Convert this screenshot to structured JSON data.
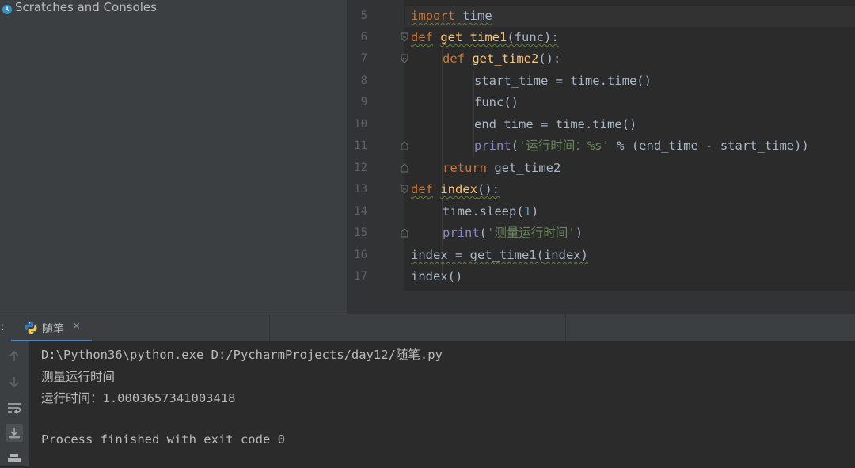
{
  "project_panel": {
    "item_label": "Scratches and Consoles"
  },
  "editor": {
    "lines": [
      {
        "num": "5"
      },
      {
        "num": "6"
      },
      {
        "num": "7"
      },
      {
        "num": "8"
      },
      {
        "num": "9"
      },
      {
        "num": "10"
      },
      {
        "num": "11"
      },
      {
        "num": "12"
      },
      {
        "num": "13"
      },
      {
        "num": "14"
      },
      {
        "num": "15"
      },
      {
        "num": "16"
      },
      {
        "num": "17"
      }
    ],
    "code": {
      "l5": {
        "kw": "import",
        "rest": " time"
      },
      "l6": {
        "kw": "def",
        "fn": "get_time1",
        "rest": "(func):"
      },
      "l7": {
        "kw": "def",
        "fn": "get_time2",
        "rest": "():"
      },
      "l8": {
        "text": "start_time = time.time()"
      },
      "l9": {
        "text": "func()"
      },
      "l10": {
        "text": "end_time = time.time()"
      },
      "l11": {
        "bi": "print",
        "open": "(",
        "str": "'运行时间：%s'",
        "rest": " % (end_time - start_time))"
      },
      "l12": {
        "kw": "return",
        "rest": " get_time2"
      },
      "l13": {
        "kw": "def",
        "fn": "index",
        "rest": "():"
      },
      "l14": {
        "pre": "time.sleep(",
        "num": "1",
        "post": ")"
      },
      "l15": {
        "bi": "print",
        "open": "(",
        "str": "'测量运行时间'",
        "rest": ")"
      },
      "l16": {
        "text": "index = get_time1(index)"
      },
      "l17": {
        "text": "index()"
      }
    }
  },
  "run_window": {
    "header_prefix": ":",
    "tab_label": "随笔",
    "tab_close": "✕",
    "output_lines": [
      "D:\\Python36\\python.exe D:/PycharmProjects/day12/随笔.py",
      "测量运行时间",
      "运行时间：1.0003657341003418",
      "",
      "Process finished with exit code 0"
    ]
  }
}
